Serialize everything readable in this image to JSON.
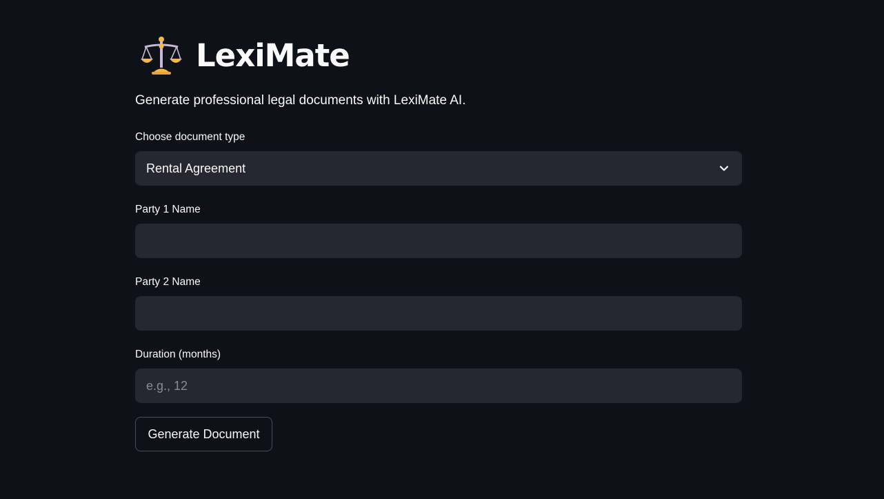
{
  "app": {
    "title": "LexiMate",
    "title_icon": "balance-scale-icon",
    "subtitle": "Generate professional legal documents with LexiMate AI."
  },
  "form": {
    "document_type": {
      "label": "Choose document type",
      "selected": "Rental Agreement",
      "icon": "chevron-down-icon"
    },
    "party1": {
      "label": "Party 1 Name",
      "value": "",
      "placeholder": ""
    },
    "party2": {
      "label": "Party 2 Name",
      "value": "",
      "placeholder": ""
    },
    "duration": {
      "label": "Duration (months)",
      "value": "",
      "placeholder": "e.g., 12"
    },
    "submit_label": "Generate Document"
  },
  "colors": {
    "background": "#0e1117",
    "input_background": "#262730",
    "text": "#fafafa",
    "placeholder": "#8a8c94",
    "button_border": "#4a4d57"
  }
}
